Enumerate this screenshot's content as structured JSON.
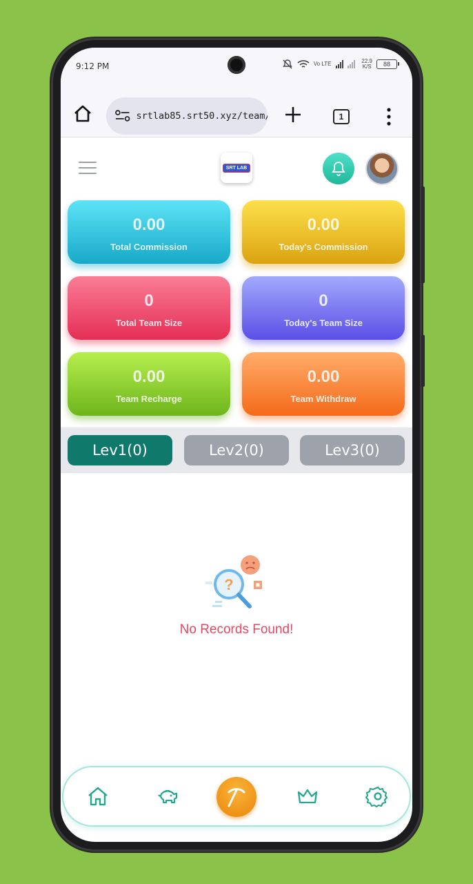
{
  "status_bar": {
    "time": "9:12 PM",
    "network": "Vo LTE",
    "speed_value": "22.9",
    "speed_unit": "K/S",
    "battery": "88"
  },
  "browser": {
    "url": "srtlab85.srt50.xyz/team/",
    "tab_count": "1"
  },
  "header": {
    "logo_text": "SRT LAB"
  },
  "stats": {
    "total_commission": {
      "value": "0.00",
      "label": "Total Commission"
    },
    "todays_commission": {
      "value": "0.00",
      "label": "Today's Commission"
    },
    "total_team_size": {
      "value": "0",
      "label": "Total Team Size"
    },
    "todays_team_size": {
      "value": "0",
      "label": "Today's Team Size"
    },
    "team_recharge": {
      "value": "0.00",
      "label": "Team Recharge"
    },
    "team_withdraw": {
      "value": "0.00",
      "label": "Team Withdraw"
    }
  },
  "levels": [
    {
      "label": "Lev1(0)",
      "active": true
    },
    {
      "label": "Lev2(0)",
      "active": false
    },
    {
      "label": "Lev3(0)",
      "active": false
    }
  ],
  "empty_state": {
    "message": "No Records Found!",
    "icon": "magnifier-question-icon"
  },
  "bottom_nav": {
    "items": [
      "home-icon",
      "piggy-bank-icon",
      "pickaxe-icon",
      "crown-icon",
      "gear-icon"
    ]
  },
  "colors": {
    "accent_teal": "#0f7a6c",
    "inactive_tab": "#9ea3ab",
    "empty_text": "#e5475f",
    "center_nav": "#f29a1f",
    "page_background": "#8bc34a"
  }
}
